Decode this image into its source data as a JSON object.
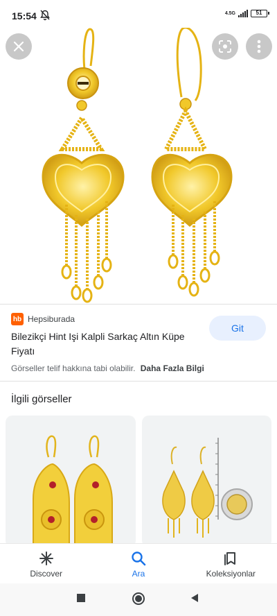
{
  "status_bar": {
    "time": "15:54",
    "network": "4.5G",
    "battery": "51"
  },
  "image_viewer": {
    "close_icon": "close-icon",
    "lens_icon": "lens-icon",
    "more_icon": "more-vert-icon"
  },
  "result": {
    "source_logo": "hb",
    "source_name": "Hepsiburada",
    "title": "Bilezikçi Hint Işi Kalpli Sarkaç Altın Küpe Fiyatı",
    "visit_label": "Git",
    "copyright_text": "Görseller telif hakkına tabi olabilir.",
    "more_info": "Daha Fazla Bilgi"
  },
  "related": {
    "title": "İlgili görseller"
  },
  "bottom_nav": {
    "items": [
      {
        "label": "Discover",
        "icon": "asterisk-icon"
      },
      {
        "label": "Ara",
        "icon": "search-icon"
      },
      {
        "label": "Koleksiyonlar",
        "icon": "collections-icon"
      }
    ],
    "active_index": 1
  },
  "colors": {
    "accent": "#1a73e8",
    "gold": "#e9b916",
    "source_brand": "#ff6000"
  }
}
